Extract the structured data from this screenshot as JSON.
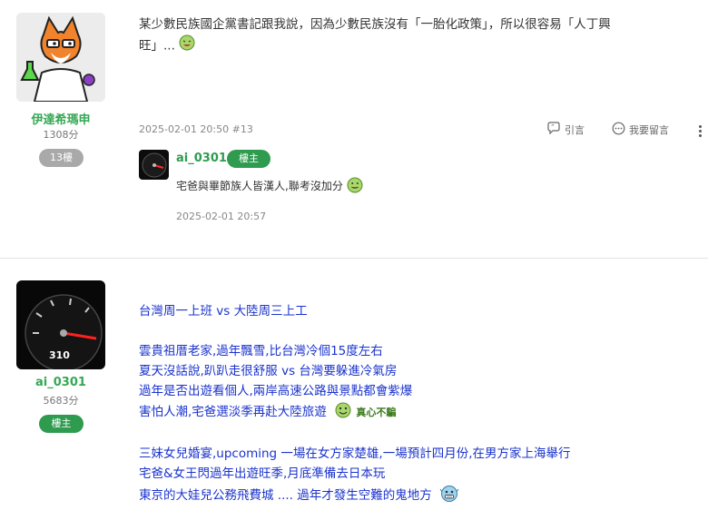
{
  "post13": {
    "username": "伊達希瑪申",
    "points": "1308分",
    "floor_badge": "13樓",
    "text_line1": "某少數民族國企黨書記跟我說，因為少數民族沒有「一胎化政策」，所以很容易「人丁興",
    "text_line2": "旺」...",
    "timestamp": "2025-02-01 20:50 #13",
    "quote_label": "引言",
    "reply_label": "我要留言",
    "reply": {
      "username": "ai_0301",
      "badge": "樓主",
      "text": "宅爸與畢節族人皆漢人,聯考沒加分",
      "timestamp": "2025-02-01 20:57"
    }
  },
  "post14": {
    "username": "ai_0301",
    "points": "5683分",
    "owner_badge": "樓主",
    "lines": [
      "台灣周一上班 vs 大陸周三上工",
      "",
      "雲貴祖厝老家,過年飄雪,比台灣冷個15度左右",
      "夏天沒話說,趴趴走很舒服 vs 台灣要躲進冷氣房",
      "過年是否出遊看個人,兩岸高速公路與景點都會紫爆",
      "害怕人潮,宅爸選淡季再赴大陸旅遊",
      "",
      "三妹女兒婚宴,upcoming 一場在女方家楚雄,一場預計四月份,在男方家上海舉行",
      "宅爸&女王閃過年出遊旺季,月底準備去日本玩",
      "東京的大娃兒公務飛費城 .... 過年才發生空難的鬼地方"
    ],
    "sticker_text": "真心不騙"
  },
  "colors": {
    "green_name": "#34a853",
    "owner_badge": "#2e9b4f",
    "blue_text": "#1a33cc"
  }
}
